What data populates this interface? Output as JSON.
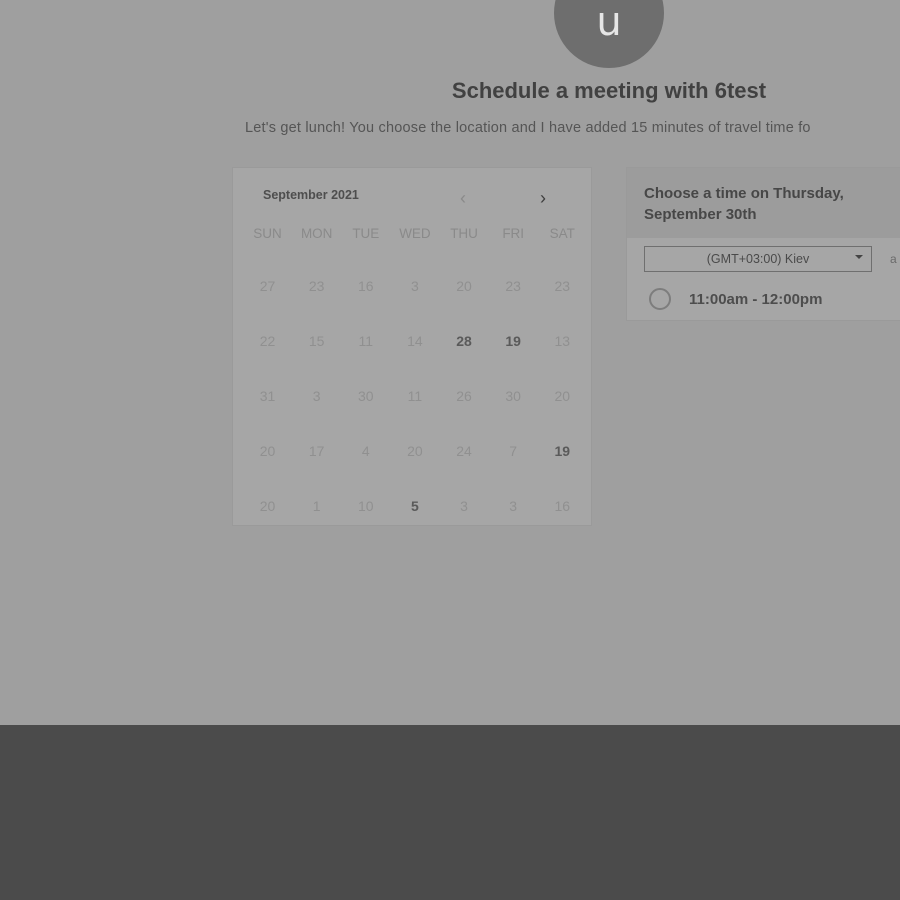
{
  "header": {
    "avatar_initial": "u",
    "title": "Schedule a meeting with 6test",
    "subtitle": "Let's get lunch! You choose the location and I have added 15 minutes of travel time fo"
  },
  "calendar": {
    "month_label": "September 2021",
    "prev_icon": "chevron-left-icon",
    "next_icon": "chevron-right-icon",
    "weekdays": [
      "SUN",
      "MON",
      "TUE",
      "WED",
      "THU",
      "FRI",
      "SAT"
    ],
    "weeks": [
      [
        "27",
        "23",
        "16",
        "3",
        "20",
        "23",
        "23"
      ],
      [
        "22",
        "15",
        "11",
        "14",
        "28",
        "19",
        "13"
      ],
      [
        "31",
        "3",
        "30",
        "11",
        "26",
        "30",
        "20"
      ],
      [
        "20",
        "17",
        "4",
        "20",
        "24",
        "7",
        "19"
      ],
      [
        "20",
        "1",
        "10",
        "5",
        "3",
        "3",
        "16"
      ]
    ],
    "available_days": [
      "28",
      "19",
      "19",
      "5"
    ]
  },
  "time_panel": {
    "heading": "Choose a time on Thursday, September 30th",
    "timezone": "(GMT+03:00) Kiev",
    "timezone_extra": "a",
    "slot_label": "11:00am - 12:00pm"
  },
  "colors": {
    "overlay": "#9f9f9f",
    "footer": "#4b4b4b"
  }
}
